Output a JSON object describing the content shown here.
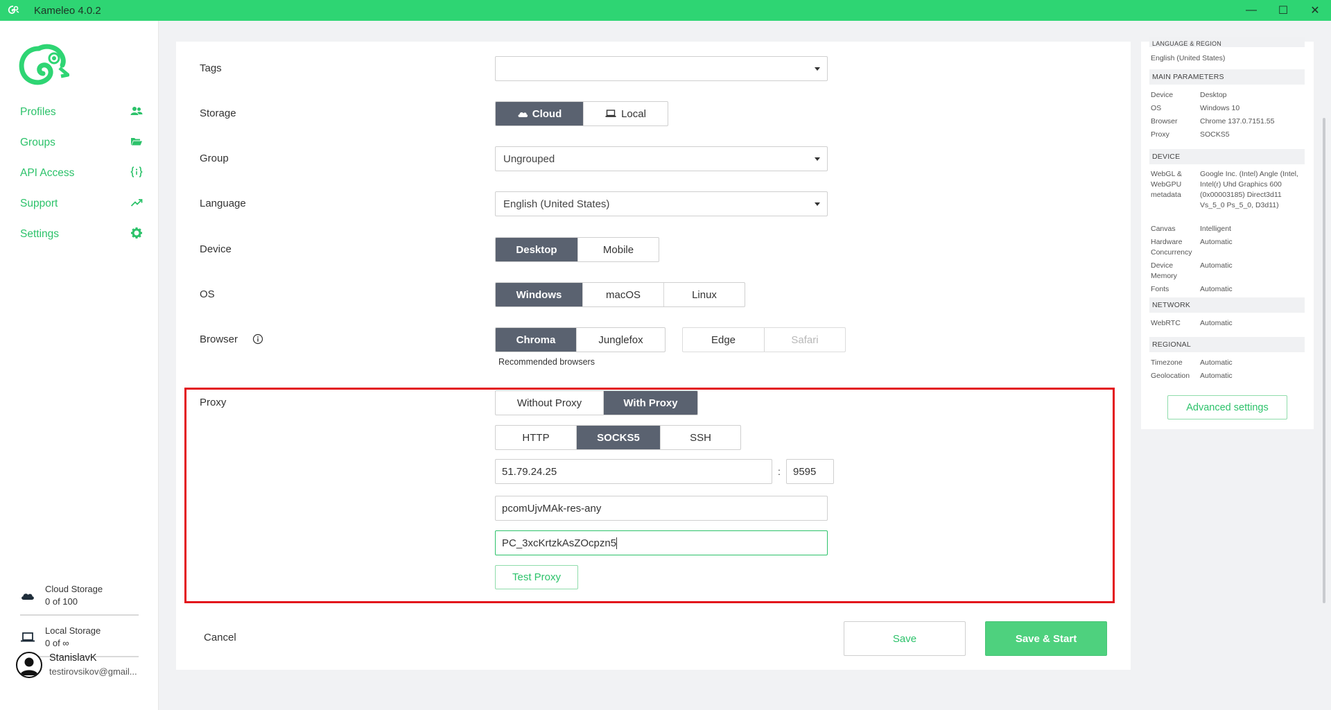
{
  "window": {
    "title": "Kameleo 4.0.2",
    "controls": [
      "—",
      "☐",
      "✕"
    ],
    "accent": "#2ed573"
  },
  "sidebar": {
    "items": [
      {
        "label": "Profiles",
        "icon": "users-icon"
      },
      {
        "label": "Groups",
        "icon": "folder-open-icon"
      },
      {
        "label": "API Access",
        "icon": "code-braces-icon"
      },
      {
        "label": "Support",
        "icon": "trend-up-icon"
      },
      {
        "label": "Settings",
        "icon": "gear-icon"
      }
    ],
    "cloud_storage": {
      "label": "Cloud Storage",
      "value": "0 of 100"
    },
    "local_storage": {
      "label": "Local Storage",
      "value": "0 of ∞"
    },
    "user": {
      "name": "StanislavK",
      "email": "testirovsikov@gmail..."
    }
  },
  "form": {
    "tags": {
      "label": "Tags",
      "value": ""
    },
    "storage": {
      "label": "Storage",
      "options": [
        "Cloud",
        "Local"
      ],
      "selected": "Cloud"
    },
    "group": {
      "label": "Group",
      "value": "Ungrouped"
    },
    "language": {
      "label": "Language",
      "value": "English (United States)"
    },
    "device": {
      "label": "Device",
      "options": [
        "Desktop",
        "Mobile"
      ],
      "selected": "Desktop"
    },
    "os": {
      "label": "OS",
      "options": [
        "Windows",
        "macOS",
        "Linux"
      ],
      "selected": "Windows"
    },
    "browser": {
      "label": "Browser",
      "recommended": [
        "Chroma",
        "Junglefox"
      ],
      "others": [
        "Edge",
        "Safari"
      ],
      "selected": "Chroma",
      "recommended_caption": "Recommended browsers"
    },
    "proxy": {
      "label": "Proxy",
      "mode_options": [
        "Without Proxy",
        "With Proxy"
      ],
      "mode_selected": "With Proxy",
      "type_options": [
        "HTTP",
        "SOCKS5",
        "SSH"
      ],
      "type_selected": "SOCKS5",
      "host": "51.79.24.25",
      "separator": ":",
      "port": "9595",
      "username": "pcomUjvMAk-res-any",
      "password": "PC_3xcKrtzkAsZOcpzn5",
      "test_label": "Test Proxy"
    },
    "cancel_label": "Cancel",
    "save_label": "Save",
    "save_start_label": "Save & Start"
  },
  "summary": {
    "language_header": "LANGUAGE & REGION",
    "language_value": "English (United States)",
    "main_header": "MAIN PARAMETERS",
    "main": [
      {
        "k": "Device",
        "v": "Desktop"
      },
      {
        "k": "OS",
        "v": "Windows 10"
      },
      {
        "k": "Browser",
        "v": "Chrome 137.0.7151.55"
      },
      {
        "k": "Proxy",
        "v": "SOCKS5"
      }
    ],
    "device_header": "DEVICE",
    "device": [
      {
        "k": "WebGL & WebGPU metadata",
        "v": "Google Inc. (Intel) Angle (Intel, Intel(r) Uhd Graphics 600 (0x00003185) Direct3d11 Vs_5_0 Ps_5_0, D3d11)"
      },
      {
        "k": "Canvas",
        "v": "Intelligent"
      },
      {
        "k": "Hardware Concurrency",
        "v": "Automatic"
      },
      {
        "k": "Device Memory",
        "v": "Automatic"
      },
      {
        "k": "Fonts",
        "v": "Automatic"
      }
    ],
    "network_header": "NETWORK",
    "network": [
      {
        "k": "WebRTC",
        "v": "Automatic"
      }
    ],
    "regional_header": "REGIONAL",
    "regional": [
      {
        "k": "Timezone",
        "v": "Automatic"
      },
      {
        "k": "Geolocation",
        "v": "Automatic"
      }
    ],
    "advanced_label": "Advanced settings"
  }
}
